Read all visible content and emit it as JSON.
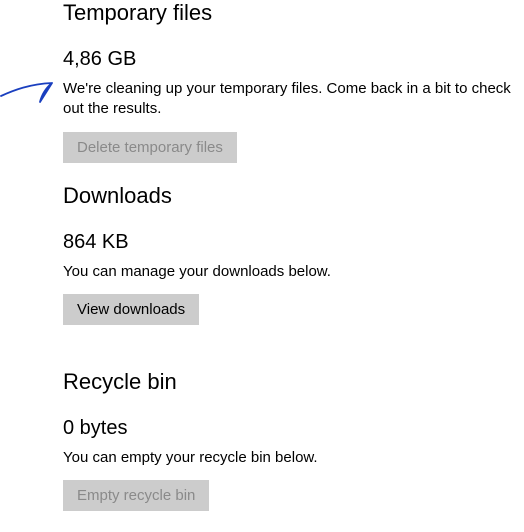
{
  "sections": {
    "temp": {
      "heading": "Temporary files",
      "size": "4,86 GB",
      "description": "We're cleaning up your temporary files. Come back in a bit to check out the results.",
      "button_label": "Delete temporary files",
      "button_enabled": false
    },
    "downloads": {
      "heading": "Downloads",
      "size": "864 KB",
      "description": "You can manage your downloads below.",
      "button_label": "View downloads",
      "button_enabled": true
    },
    "recycle": {
      "heading": "Recycle bin",
      "size": "0 bytes",
      "description": "You can empty your recycle bin below.",
      "button_label": "Empty recycle bin",
      "button_enabled": false
    }
  }
}
